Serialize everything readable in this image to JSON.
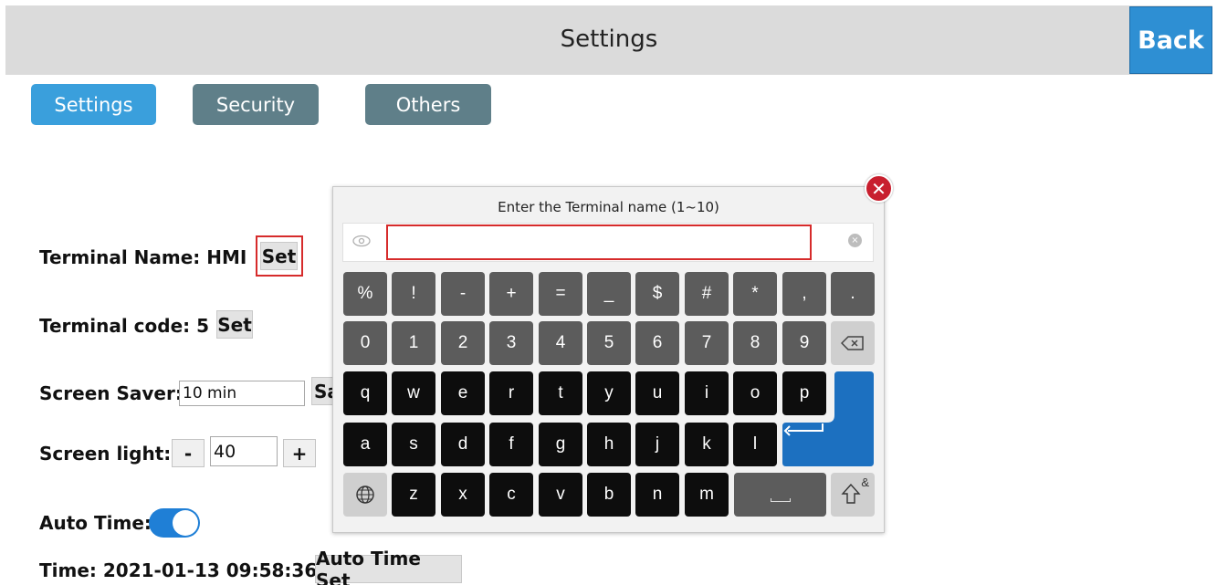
{
  "header": {
    "title": "Settings",
    "back_label": "Back"
  },
  "tabs": [
    {
      "label": "Settings",
      "active": true
    },
    {
      "label": "Security",
      "active": false
    },
    {
      "label": "Others",
      "active": false
    }
  ],
  "settings": {
    "terminal_name_label": "Terminal Name: HMI",
    "terminal_name_set": "Set",
    "terminal_code_label": "Terminal code: 5",
    "terminal_code_set": "Set",
    "screen_saver_label": "Screen Saver:",
    "screen_saver_value": "10 min",
    "screen_saver_set_partial": "Sa",
    "screen_light_label": "Screen light:",
    "screen_light_minus": "-",
    "screen_light_value": "40",
    "screen_light_plus": "+",
    "auto_time_label": "Auto Time:",
    "auto_time_on": true,
    "time_label": "Time: 2021-01-13 09:58:36",
    "auto_time_set": "Auto Time Set"
  },
  "keyboard": {
    "prompt": "Enter the Terminal name (1~10)",
    "input_value": "",
    "close_icon": "close-icon",
    "row1": [
      "%",
      "!",
      "-",
      "+",
      "=",
      "_",
      "$",
      "#",
      "*",
      ",",
      "."
    ],
    "row2": [
      "0",
      "1",
      "2",
      "3",
      "4",
      "5",
      "6",
      "7",
      "8",
      "9"
    ],
    "row3": [
      "q",
      "w",
      "e",
      "r",
      "t",
      "y",
      "u",
      "i",
      "o",
      "p"
    ],
    "row4": [
      "a",
      "s",
      "d",
      "f",
      "g",
      "h",
      "j",
      "k",
      "l"
    ],
    "row5": [
      "z",
      "x",
      "c",
      "v",
      "b",
      "n",
      "m"
    ],
    "shift_symbol": "&",
    "colors": {
      "accent": "#2e8fd3",
      "enter": "#1c70c0",
      "key_dark": "#0d0d0d",
      "key_gray": "#5c5c5c",
      "close": "#c81f2e"
    }
  }
}
